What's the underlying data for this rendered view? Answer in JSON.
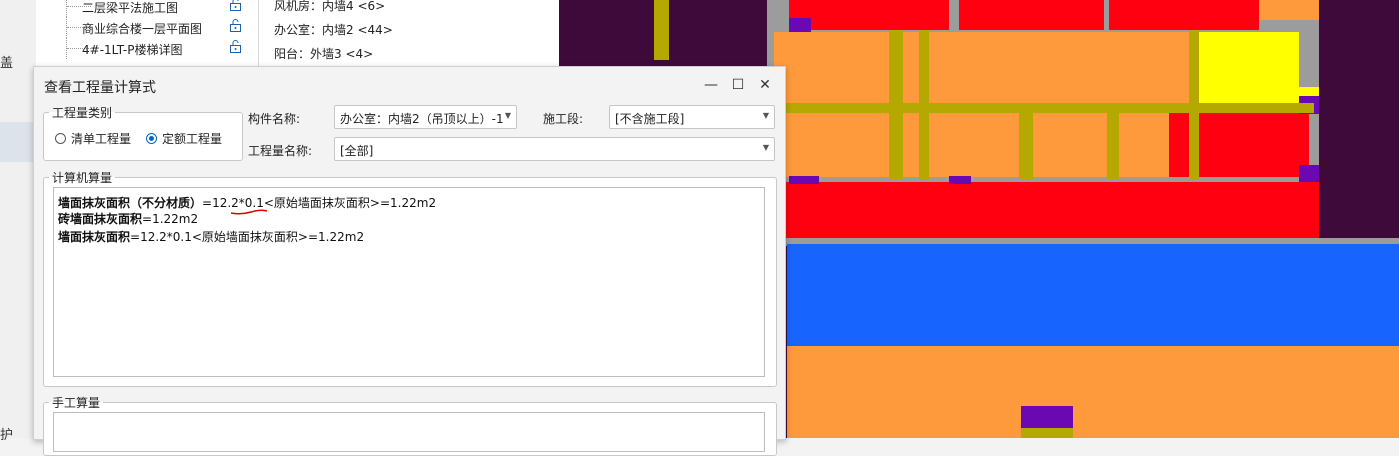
{
  "app_left": {
    "char_top": "盖",
    "char_bottom": "护"
  },
  "drawing_list": [
    {
      "name": "二层梁平法施工图"
    },
    {
      "name": "商业综合楼一层平面图"
    },
    {
      "name": "4#-1LT-P楼梯详图"
    }
  ],
  "component_list": [
    "风机房：内墙4 <6>",
    "办公室：内墙2 <44>",
    "阳台：外墙3 <4>"
  ],
  "dialog": {
    "title": "查看工程量计算式",
    "quantity_type": {
      "legend": "工程量类别",
      "options": [
        {
          "label": "清单工程量",
          "selected": false
        },
        {
          "label": "定额工程量",
          "selected": true
        }
      ]
    },
    "component_name": {
      "label": "构件名称:",
      "value": "办公室：内墙2（吊顶以上）-1"
    },
    "construction_stage": {
      "label": "施工段:",
      "value": "[不含施工段]"
    },
    "quantity_name": {
      "label": "工程量名称:",
      "value": "[全部]"
    },
    "computer_calc": {
      "legend": "计算机算量",
      "lines": [
        {
          "name": "墙面抹灰面积（不分材质）",
          "formula": "=12.2*0.1<原始墙面抹灰面积>=1.22m2"
        },
        {
          "name": "砖墙面抹灰面积",
          "formula": "=1.22m2"
        },
        {
          "name": "墙面抹灰面积",
          "formula": "=12.2*0.1<原始墙面抹灰面积>=1.22m2"
        }
      ]
    },
    "manual_calc": {
      "legend": "手工算量"
    }
  },
  "colors": {
    "canvas_bg": "#3e0a3a",
    "wall_red": "#ff0010",
    "floor_orange": "#ff9a3c",
    "blue_zone": "#1764ff",
    "yellow_zone": "#ffff00",
    "beam_olive": "#b5a800",
    "column_purple": "#6a08b3",
    "selected_radio": "#0067c0"
  }
}
